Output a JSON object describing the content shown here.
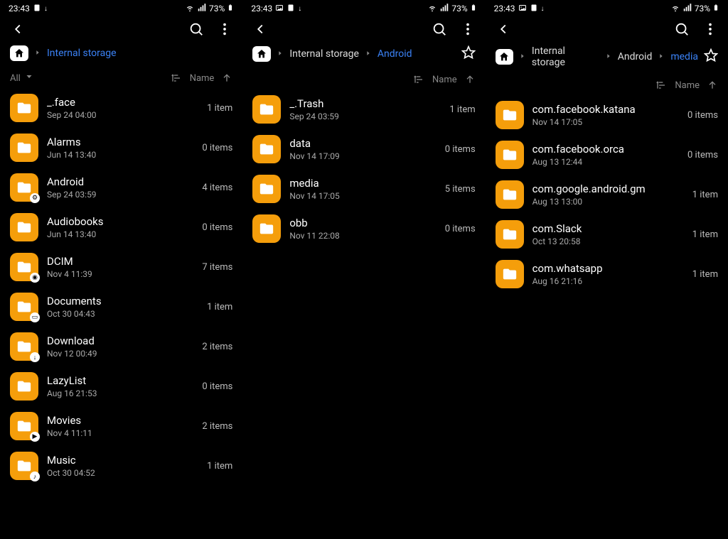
{
  "panes": [
    {
      "status": {
        "time": "23:43",
        "battery": "73%"
      },
      "breadcrumb": {
        "segments": [
          {
            "label": "Internal storage",
            "active": true
          }
        ]
      },
      "starred": false,
      "has_all_filter": true,
      "all_label": "All",
      "sort_label": "Name",
      "items": [
        {
          "name": "_.face",
          "date": "Sep 24 04:00",
          "count": "1 item",
          "badge": null
        },
        {
          "name": "Alarms",
          "date": "Jun 14 13:40",
          "count": "0 items",
          "badge": null
        },
        {
          "name": "Android",
          "date": "Sep 24 03:59",
          "count": "4 items",
          "badge": "gear"
        },
        {
          "name": "Audiobooks",
          "date": "Jun 14 13:40",
          "count": "0 items",
          "badge": null
        },
        {
          "name": "DCIM",
          "date": "Nov 4 11:39",
          "count": "7 items",
          "badge": "camera"
        },
        {
          "name": "Documents",
          "date": "Oct 30 04:43",
          "count": "1 item",
          "badge": "doc"
        },
        {
          "name": "Download",
          "date": "Nov 12 00:49",
          "count": "2 items",
          "badge": "download"
        },
        {
          "name": "LazyList",
          "date": "Aug 16 21:53",
          "count": "0 items",
          "badge": null
        },
        {
          "name": "Movies",
          "date": "Nov 4 11:11",
          "count": "2 items",
          "badge": "play"
        },
        {
          "name": "Music",
          "date": "Oct 30 04:52",
          "count": "1 item",
          "badge": "music"
        }
      ]
    },
    {
      "status": {
        "time": "23:43",
        "battery": "73%"
      },
      "breadcrumb": {
        "segments": [
          {
            "label": "Internal storage",
            "active": false
          },
          {
            "label": "Android",
            "active": true
          }
        ]
      },
      "starred": true,
      "has_all_filter": false,
      "sort_label": "Name",
      "items": [
        {
          "name": "_.Trash",
          "date": "Sep 24 03:59",
          "count": "1 item",
          "badge": null
        },
        {
          "name": "data",
          "date": "Nov 14 17:09",
          "count": "0 items",
          "badge": null
        },
        {
          "name": "media",
          "date": "Nov 14 17:05",
          "count": "5 items",
          "badge": null
        },
        {
          "name": "obb",
          "date": "Nov 11 22:08",
          "count": "0 items",
          "badge": null
        }
      ]
    },
    {
      "status": {
        "time": "23:43",
        "battery": "73%"
      },
      "breadcrumb": {
        "segments": [
          {
            "label": "Internal storage",
            "active": false
          },
          {
            "label": "Android",
            "active": false
          },
          {
            "label": "media",
            "active": true
          }
        ]
      },
      "starred": true,
      "has_all_filter": false,
      "sort_label": "Name",
      "items": [
        {
          "name": "com.facebook.katana",
          "date": "Nov 14 17:05",
          "count": "0 items",
          "badge": null
        },
        {
          "name": "com.facebook.orca",
          "date": "Aug 13 12:44",
          "count": "0 items",
          "badge": null
        },
        {
          "name": "com.google.android.gm",
          "date": "Aug 13 13:00",
          "count": "1 item",
          "badge": null
        },
        {
          "name": "com.Slack",
          "date": "Oct 13 20:58",
          "count": "1 item",
          "badge": null
        },
        {
          "name": "com.whatsapp",
          "date": "Aug 16 21:16",
          "count": "1 item",
          "badge": null
        }
      ]
    }
  ]
}
